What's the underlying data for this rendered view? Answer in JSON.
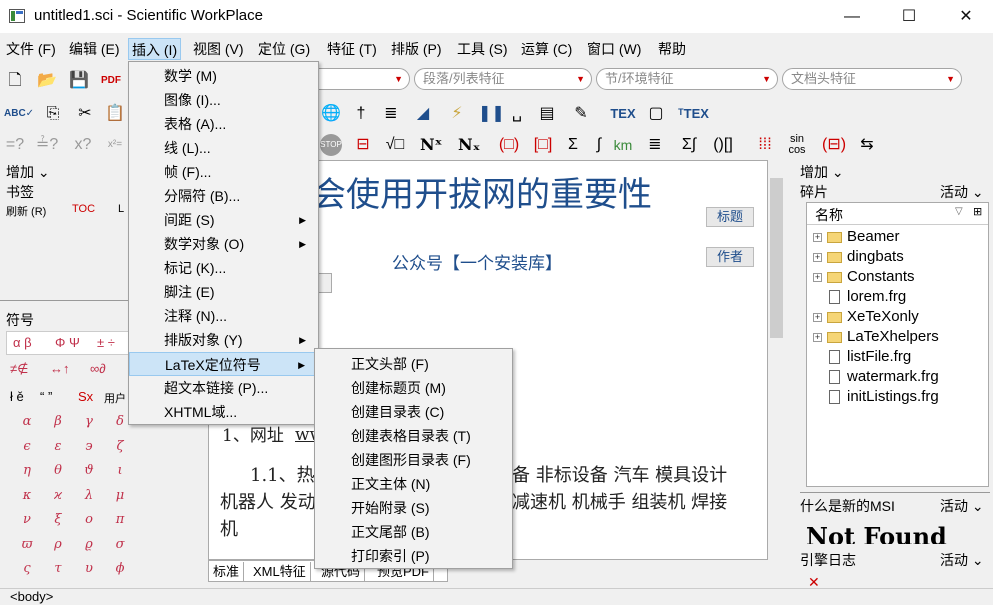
{
  "window": {
    "title": "untitled1.sci - Scientific WorkPlace",
    "minimize": "—",
    "maximize": "☐",
    "close": "✕"
  },
  "menubar": [
    "文件 (F)",
    "编辑 (E)",
    "插入 (I)",
    "视图 (V)",
    "定位 (G)",
    "特征 (T)",
    "排版 (P)",
    "工具 (S)",
    "运算 (C)",
    "窗口 (W)",
    "帮助"
  ],
  "combos": [
    "特征",
    "段落/列表特征",
    "节/环境特征",
    "文档头特征"
  ],
  "left": {
    "add_label": "增加",
    "bookmarks_label": "书签",
    "bookmark_row": [
      "刷新 (R)",
      "TOC",
      "L"
    ],
    "symbols_label": "符号",
    "sym_tabs": [
      "α β",
      "Φ Ψ",
      "± ÷"
    ],
    "sym_row2": [
      "≠∉",
      "↔↑",
      "∞∂"
    ],
    "sym_row3": [
      "ł ě",
      "“ ”",
      "Sx",
      "用户"
    ],
    "greek": [
      "α",
      "β",
      "γ",
      "δ",
      "ϵ",
      "ε",
      "϶",
      "ζ",
      "η",
      "θ",
      "ϑ",
      "ι",
      "κ",
      "ϰ",
      "λ",
      "μ",
      "ν",
      "ξ",
      "ο",
      "π",
      "ϖ",
      "ρ",
      "ϱ",
      "σ",
      "ς",
      "τ",
      "υ",
      "ϕ"
    ]
  },
  "document": {
    "title": "会使用开拔网的重要性",
    "title_tag": "标题",
    "author": "公众号【一个安装库】",
    "author_tag": "作者",
    "line1": "1、网址",
    "line1_tail": "ww",
    "para_prefix": "1.1、热",
    "para_line1_end": "备 非标设备 汽车 模具设计",
    "para_line2_start": "机器人 发动",
    "para_line2_end": "减速机 机械手 组装机 焊接",
    "para_line3": "机",
    "tabs": [
      "标准",
      "XML特征",
      "源代码",
      "预览PDF"
    ]
  },
  "right": {
    "add_label": "增加",
    "fragments_label": "碎片",
    "activity": "活动",
    "name_col": "名称",
    "tree": [
      {
        "label": "Beamer",
        "type": "folder"
      },
      {
        "label": "dingbats",
        "type": "folder"
      },
      {
        "label": "Constants",
        "type": "folder"
      },
      {
        "label": "lorem.frg",
        "type": "file"
      },
      {
        "label": "XeTeXonly",
        "type": "folder"
      },
      {
        "label": "LaTeXhelpers",
        "type": "folder"
      },
      {
        "label": "listFile.frg",
        "type": "file"
      },
      {
        "label": "watermark.frg",
        "type": "file"
      },
      {
        "label": "initListings.frg",
        "type": "file"
      }
    ],
    "whats_new": "什么是新的MSI",
    "not_found": "Not Found",
    "engine_log": "引擎日志"
  },
  "insert_menu": [
    {
      "label": "数学 (M)",
      "submenu": false
    },
    {
      "label": "图像 (I)...",
      "submenu": false
    },
    {
      "label": "表格 (A)...",
      "submenu": false
    },
    {
      "label": "线 (L)...",
      "submenu": false
    },
    {
      "label": "帧 (F)...",
      "submenu": false
    },
    {
      "label": "分隔符 (B)...",
      "submenu": false
    },
    {
      "label": "间距 (S)",
      "submenu": true
    },
    {
      "label": "数学对象 (O)",
      "submenu": true
    },
    {
      "label": "标记 (K)...",
      "submenu": false
    },
    {
      "label": "脚注 (E)",
      "submenu": false
    },
    {
      "label": "注释 (N)...",
      "submenu": false
    },
    {
      "label": "排版对象 (Y)",
      "submenu": true
    },
    {
      "label": "LaTeX定位符号",
      "submenu": true
    },
    {
      "label": "超文本链接 (P)...",
      "submenu": false
    },
    {
      "label": "XHTML域...",
      "submenu": false
    }
  ],
  "latex_submenu": [
    "正文头部 (F)",
    "创建标题页 (M)",
    "创建目录表 (C)",
    "创建表格目录表 (T)",
    "创建图形目录表 (F)",
    "正文主体 (N)",
    "开始附录 (S)",
    "正文尾部 (B)",
    "打印索引 (P)"
  ],
  "status": "<body>"
}
